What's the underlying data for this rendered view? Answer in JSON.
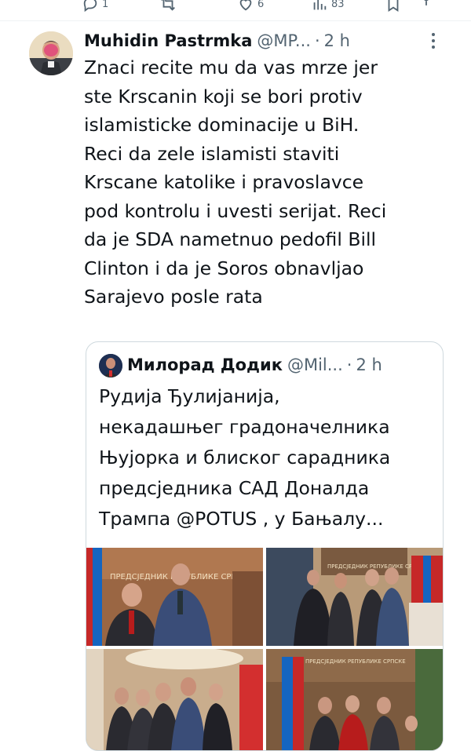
{
  "actions": {
    "reply_count": "1",
    "like_count": "6",
    "views_count": "83"
  },
  "tweet": {
    "author_name": "Muhidin Pastrmka",
    "author_handle": "@MP...",
    "separator": "·",
    "time": "2 h",
    "text": "Znaci recite mu da vas mrze jer\nste Krscanin koji se bori protiv\nislamisticke dominacije u BiH.\nReci da zele islamisti staviti\nKrscane katolike i pravoslavce\npod kontrolu i uvesti serijat. Reci\nda je SDA nametnuo pedofil Bill\nClinton i da je Soros obnavljao\nSarajevo posle rata"
  },
  "quote": {
    "author_name": "Милорад Додик",
    "author_handle": "@Mil...",
    "separator": "·",
    "time": "2 h",
    "text": "Рудија Ђулијанија,\nнекадашњег градоначелника\nЊујорка и блиског сарадника\nпредсједника САД Доналда\nТрампа @POTUS , у Бањалу...",
    "photo_captions": {
      "p1_wall": "ПРЕДСЈЕДНИК РЕПУБЛИКЕ СРПСКЕ",
      "p2_wall": "ПРЕДСЈЕДНИК РЕПУБЛИКЕ СРПСКЕ",
      "p4_wall": "ПРЕДСЈЕДНИК РЕПУБЛИКЕ СРПСКЕ"
    }
  },
  "colors": {
    "text": "#0f1419",
    "muted": "#536471",
    "border": "#cfd9de"
  }
}
